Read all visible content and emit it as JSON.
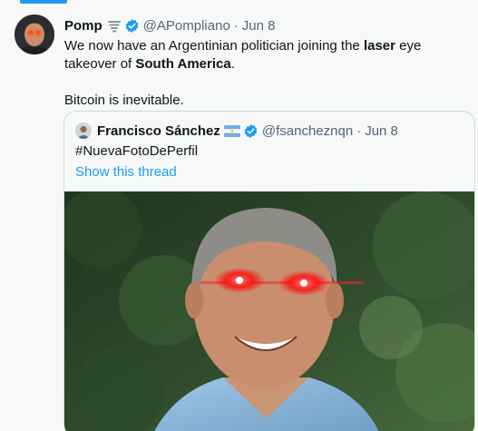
{
  "tweet": {
    "name": "Pomp",
    "emoji_icon": "tornado-icon",
    "handle": "@APompliano",
    "separator": "·",
    "date": "Jun 8",
    "text_before_laser": "We now have an Argentinian politician joining the ",
    "text_laser": "laser",
    "text_after_laser": " eye takeover of ",
    "text_south_america": "South America",
    "text_period": ".",
    "text_second": "Bitcoin is inevitable."
  },
  "quote": {
    "name": "Francisco Sánchez",
    "flag_icon": "argentina-flag-icon",
    "handle": "@fsancheznqn",
    "separator": "·",
    "date": "Jun 8",
    "hashtag": "#NuevaFotoDePerfil",
    "show_thread": "Show this thread"
  },
  "colors": {
    "accent": "#1d9bf0",
    "text": "#0f1419",
    "secondary": "#536471",
    "laser": "#ff1a1a"
  }
}
